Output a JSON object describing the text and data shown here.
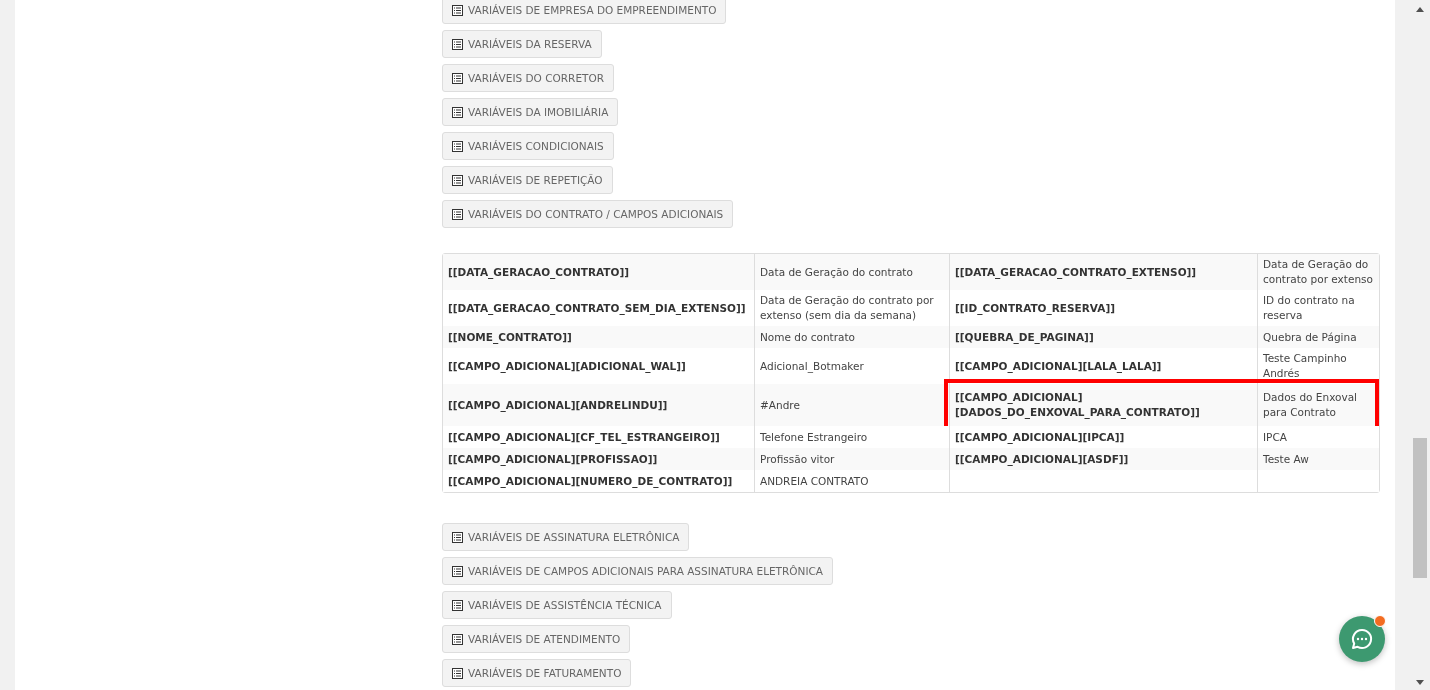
{
  "buttons_top": [
    "VARIÁVEIS DE EMPRESA DO EMPREENDIMENTO",
    "VARIÁVEIS DA RESERVA",
    "VARIÁVEIS DO CORRETOR",
    "VARIÁVEIS DA IMOBILIÁRIA",
    "VARIÁVEIS CONDICIONAIS",
    "VARIÁVEIS DE REPETIÇÃO",
    "VARIÁVEIS DO CONTRATO / CAMPOS ADICIONAIS"
  ],
  "table": {
    "rows": [
      {
        "cells": [
          "[[DATA_GERACAO_CONTRATO]]",
          "Data de Geração do contrato",
          "[[DATA_GERACAO_CONTRATO_EXTENSO]]",
          "Data de Geração do contrato por extenso"
        ],
        "highlighted": false
      },
      {
        "cells": [
          "[[DATA_GERACAO_CONTRATO_SEM_DIA_EXTENSO]]",
          "Data de Geração do contrato por extenso (sem dia da semana)",
          "[[ID_CONTRATO_RESERVA]]",
          "ID do contrato na reserva"
        ],
        "highlighted": false
      },
      {
        "cells": [
          "[[NOME_CONTRATO]]",
          "Nome do contrato",
          "[[QUEBRA_DE_PAGINA]]",
          "Quebra de Página"
        ],
        "highlighted": false
      },
      {
        "cells": [
          "[[CAMPO_ADICIONAL][ADICIONAL_WAL]]",
          "Adicional_Botmaker",
          "[[CAMPO_ADICIONAL][LALA_LALA]]",
          "Teste Campinho Andrés"
        ],
        "highlighted": false
      },
      {
        "cells": [
          "[[CAMPO_ADICIONAL][ANDRELINDU]]",
          "#Andre",
          "[[CAMPO_ADICIONAL][DADOS_DO_ENXOVAL_PARA_CONTRATO]]",
          "Dados do Enxoval para Contrato"
        ],
        "highlighted": true
      },
      {
        "cells": [
          "[[CAMPO_ADICIONAL][CF_TEL_ESTRANGEIRO]]",
          "Telefone Estrangeiro",
          "[[CAMPO_ADICIONAL][IPCA]]",
          "IPCA"
        ],
        "highlighted": false
      },
      {
        "cells": [
          "[[CAMPO_ADICIONAL][PROFISSAO]]",
          "Profissão vitor",
          "[[CAMPO_ADICIONAL][ASDF]]",
          "Teste Aw"
        ],
        "highlighted": false
      },
      {
        "cells": [
          "[[CAMPO_ADICIONAL][NUMERO_DE_CONTRATO]]",
          "ANDREIA CONTRATO"
        ],
        "highlighted": false
      }
    ]
  },
  "buttons_bottom": [
    "VARIÁVEIS DE ASSINATURA ELETRÔNICA",
    "VARIÁVEIS DE CAMPOS ADICIONAIS PARA ASSINATURA ELETRÔNICA",
    "VARIÁVEIS DE ASSISTÊNCIA TÉCNICA",
    "VARIÁVEIS DE ATENDIMENTO",
    "VARIÁVEIS DE FATURAMENTO"
  ]
}
